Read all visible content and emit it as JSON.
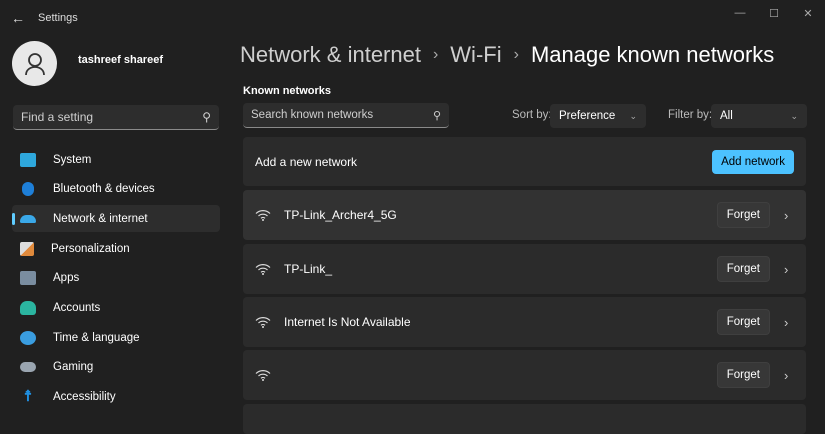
{
  "app": {
    "title": "Settings"
  },
  "user": {
    "name": "tashreef shareef"
  },
  "find": {
    "placeholder": "Find a setting"
  },
  "nav": [
    {
      "label": "System",
      "color": "#2ea7dc"
    },
    {
      "label": "Bluetooth & devices",
      "color": "#1e7fd8"
    },
    {
      "label": "Network & internet",
      "color": "#3aa8e8"
    },
    {
      "label": "Personalization",
      "color": "#e08a3c"
    },
    {
      "label": "Apps",
      "color": "#7a8da0"
    },
    {
      "label": "Accounts",
      "color": "#2bb5a0"
    },
    {
      "label": "Time & language",
      "color": "#3a9de0"
    },
    {
      "label": "Gaming",
      "color": "#9aa5b0"
    },
    {
      "label": "Accessibility",
      "color": "#1f8fe0"
    }
  ],
  "breadcrumb": {
    "items": [
      "Network & internet",
      "Wi-Fi"
    ],
    "current": "Manage known networks"
  },
  "known": {
    "heading": "Known networks",
    "search_placeholder": "Search known networks",
    "sort_label": "Sort by:",
    "sort_value": "Preference",
    "filter_label": "Filter by:",
    "filter_value": "All"
  },
  "add": {
    "label": "Add a new network",
    "button": "Add network"
  },
  "networks": [
    {
      "name": "TP-Link_Archer4_5G",
      "forget": "Forget"
    },
    {
      "name": "TP-Link_",
      "forget": "Forget"
    },
    {
      "name": "Internet Is Not Available",
      "forget": "Forget"
    },
    {
      "name": "",
      "forget": "Forget"
    }
  ]
}
